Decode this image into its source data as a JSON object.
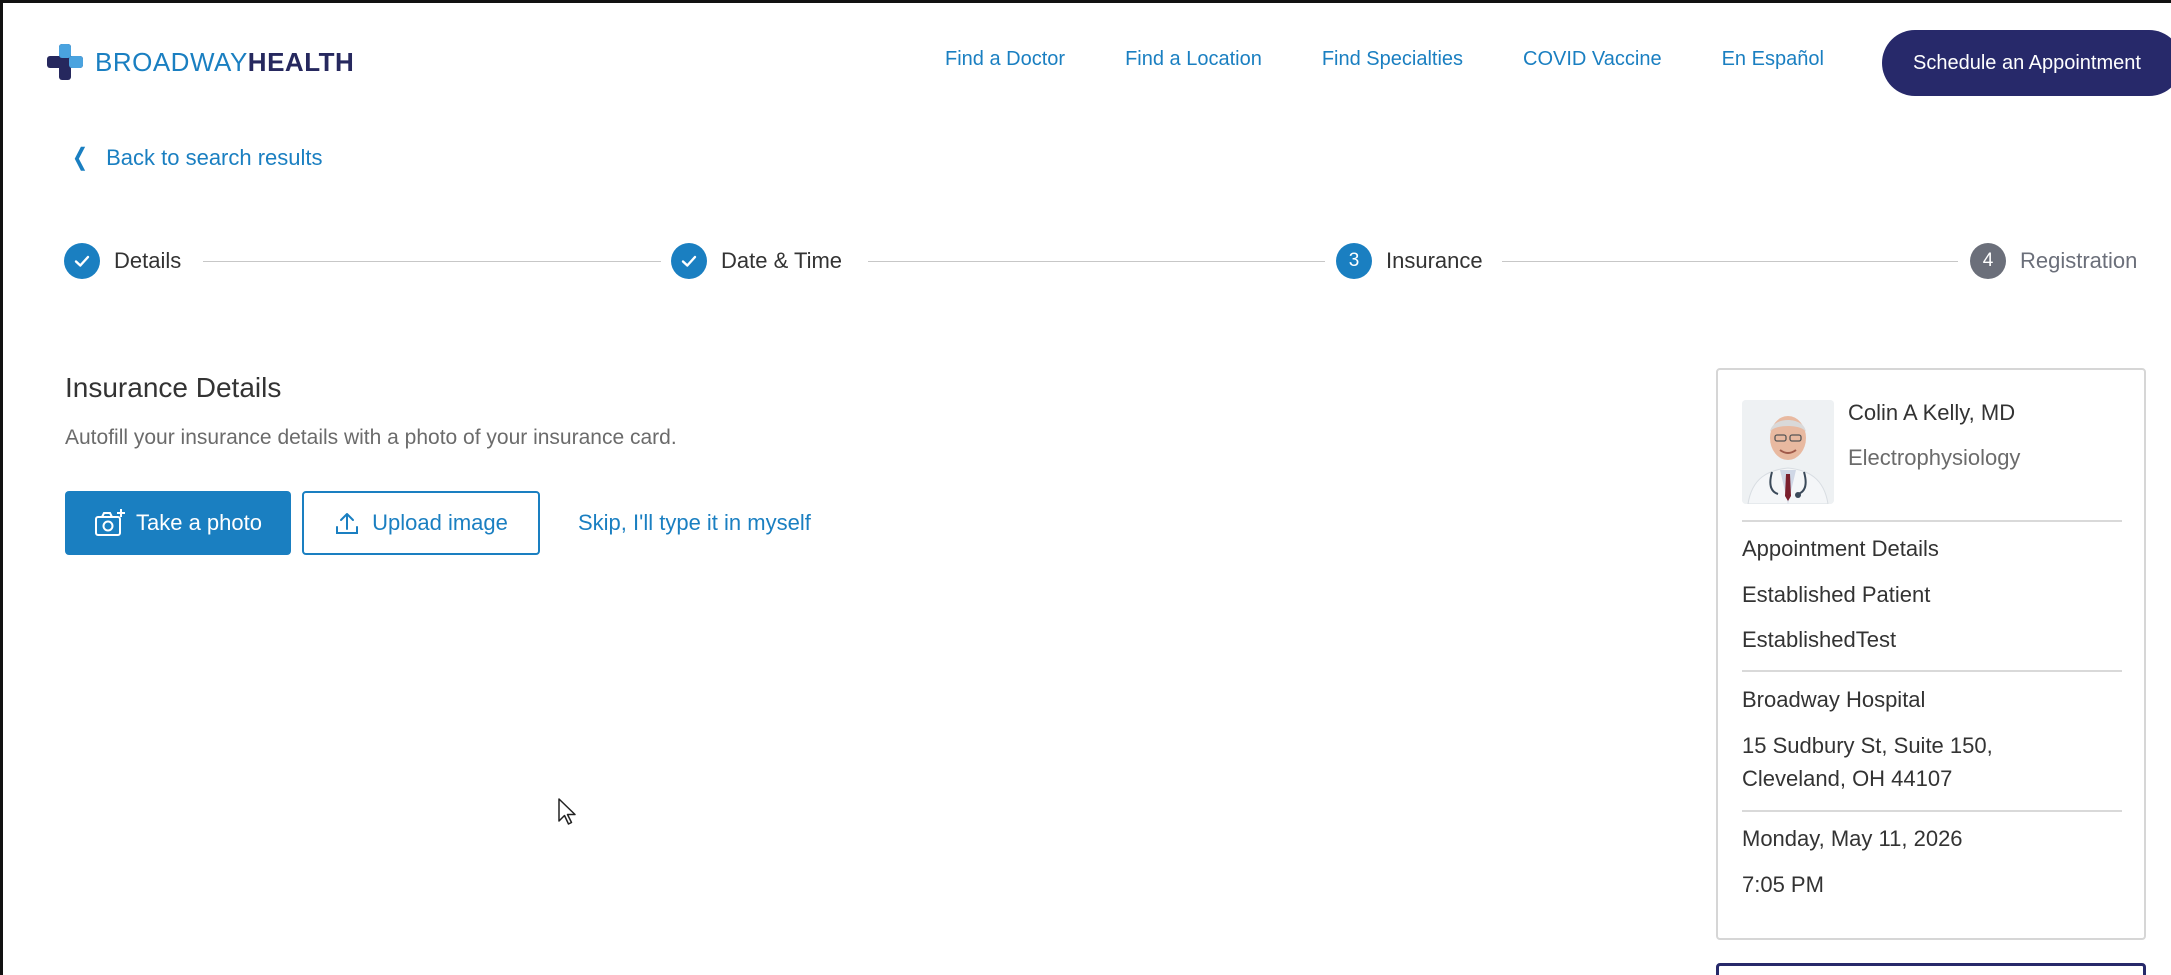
{
  "header": {
    "brand_light": "BROADWAY",
    "brand_bold": "HEALTH",
    "nav": [
      "Find a Doctor",
      "Find a Location",
      "Find Specialties",
      "COVID Vaccine",
      "En Español"
    ],
    "schedule_label": "Schedule an Appointment",
    "colors": {
      "brand_blue": "#1a7fc1",
      "navy": "#27296a"
    }
  },
  "back_label": "Back to search results",
  "stepper": [
    {
      "label": "Details",
      "status": "done",
      "marker": ""
    },
    {
      "label": "Date & Time",
      "status": "done",
      "marker": ""
    },
    {
      "label": "Insurance",
      "status": "current",
      "marker": "3"
    },
    {
      "label": "Registration",
      "status": "todo",
      "marker": "4"
    }
  ],
  "insurance": {
    "title": "Insurance Details",
    "subtitle": "Autofill your insurance details with a photo of your insurance card.",
    "take_photo": "Take a photo",
    "upload_image": "Upload image",
    "skip": "Skip, I'll type it in myself"
  },
  "summary": {
    "doctor_name": "Colin A Kelly, MD",
    "specialty": "Electrophysiology",
    "appt_heading": "Appointment Details",
    "patient_type": "Established Patient",
    "visit_type": "EstablishedTest",
    "location_name": "Broadway Hospital",
    "address_line1": "15 Sudbury St, Suite 150,",
    "address_line2": "Cleveland, OH 44107",
    "date": "Monday, May 11, 2026",
    "time": "7:05 PM"
  }
}
